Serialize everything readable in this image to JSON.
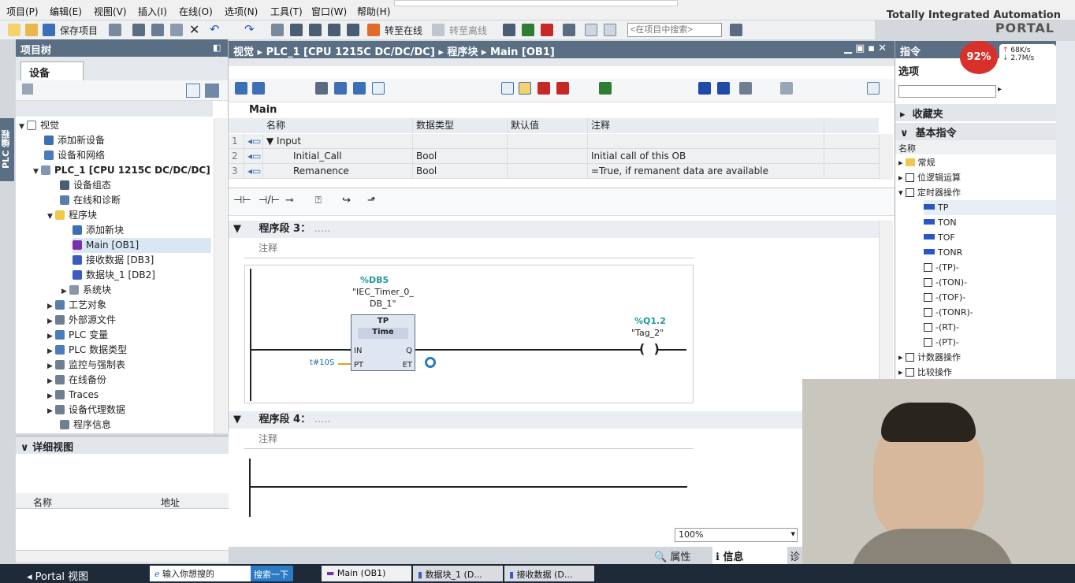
{
  "menu": [
    "项目(P)",
    "编辑(E)",
    "视图(V)",
    "插入(I)",
    "在线(O)",
    "选项(N)",
    "工具(T)",
    "窗口(W)",
    "帮助(H)"
  ],
  "toolbar": {
    "save": "保存项目",
    "go_online": "转至在线",
    "go_offline": "转至离线",
    "search_placeholder": "<在项目中搜索>"
  },
  "brand": {
    "line1": "Totally Integrated Automation",
    "line2": "PORTAL"
  },
  "side_label": "PLC 编程",
  "project_tree": {
    "title": "项目树",
    "tab": "设备",
    "items": [
      {
        "label": "视觉"
      },
      {
        "label": "添加新设备"
      },
      {
        "label": "设备和网络"
      },
      {
        "label": "PLC_1 [CPU 1215C DC/DC/DC]"
      },
      {
        "label": "设备组态"
      },
      {
        "label": "在线和诊断"
      },
      {
        "label": "程序块"
      },
      {
        "label": "添加新块"
      },
      {
        "label": "Main [OB1]"
      },
      {
        "label": "接收数据 [DB3]"
      },
      {
        "label": "数据块_1 [DB2]"
      },
      {
        "label": "系统块"
      },
      {
        "label": "工艺对象"
      },
      {
        "label": "外部源文件"
      },
      {
        "label": "PLC 变量"
      },
      {
        "label": "PLC 数据类型"
      },
      {
        "label": "监控与强制表"
      },
      {
        "label": "在线备份"
      },
      {
        "label": "Traces"
      },
      {
        "label": "设备代理数据"
      },
      {
        "label": "程序信息"
      }
    ]
  },
  "detail_view": {
    "title": "详细视图",
    "col_name": "名称",
    "col_address": "地址"
  },
  "editor": {
    "breadcrumb": [
      "视觉",
      "PLC_1 [CPU 1215C DC/DC/DC]",
      "程序块",
      "Main [OB1]"
    ],
    "block_name": "Main",
    "columns": [
      "名称",
      "数据类型",
      "默认值",
      "注释"
    ],
    "rows": [
      {
        "num": "1",
        "name": "Input",
        "type": "",
        "default": "",
        "comment": ""
      },
      {
        "num": "2",
        "name": "Initial_Call",
        "type": "Bool",
        "default": "",
        "comment": "Initial call of this OB"
      },
      {
        "num": "3",
        "name": "Remanence",
        "type": "Bool",
        "default": "",
        "comment": "=True, if remanent data are available"
      }
    ],
    "network3": {
      "title": "程序段 3：",
      "dots": ".....",
      "comment": "注释",
      "db": "%DB5",
      "instance1": "\"IEC_Timer_0_",
      "instance2": "DB_1\"",
      "block": "TP",
      "block_type": "Time",
      "pin_in": "IN",
      "pin_pt": "PT",
      "pin_q": "Q",
      "pin_et": "ET",
      "pt_value": "t#10S",
      "coil_addr": "%Q1.2",
      "coil_tag": "\"Tag_2\""
    },
    "network4": {
      "title": "程序段 4：",
      "dots": ".....",
      "comment": "注释"
    },
    "zoom": "100%"
  },
  "instructions": {
    "title": "指令",
    "options": "选项",
    "favorites": "收藏夹",
    "basic": "基本指令",
    "col_name": "名称",
    "items": [
      {
        "label": "常规"
      },
      {
        "label": "位逻辑运算"
      },
      {
        "label": "定时器操作"
      },
      {
        "label": "TP"
      },
      {
        "label": "TON"
      },
      {
        "label": "TOF"
      },
      {
        "label": "TONR"
      },
      {
        "label": "-(TP)-"
      },
      {
        "label": "-(TON)-"
      },
      {
        "label": "-(TOF)-"
      },
      {
        "label": "-(TONR)-"
      },
      {
        "label": "-(RT)-"
      },
      {
        "label": "-(PT)-"
      },
      {
        "label": "计数器操作"
      },
      {
        "label": "比较操作"
      }
    ]
  },
  "net_widget": {
    "percent": "92%",
    "up": "68K/s",
    "down": "2.7M/s"
  },
  "bottom_tabs": {
    "properties": "属性",
    "info": "信息",
    "diag": "诊"
  },
  "taskbar": {
    "portal": "Portal 视图",
    "search_ph": "输入你想搜的",
    "search_btn": "搜索一下",
    "tabs": [
      "Main (OB1)",
      "数据块_1 (D...",
      "接收数据 (D..."
    ]
  }
}
